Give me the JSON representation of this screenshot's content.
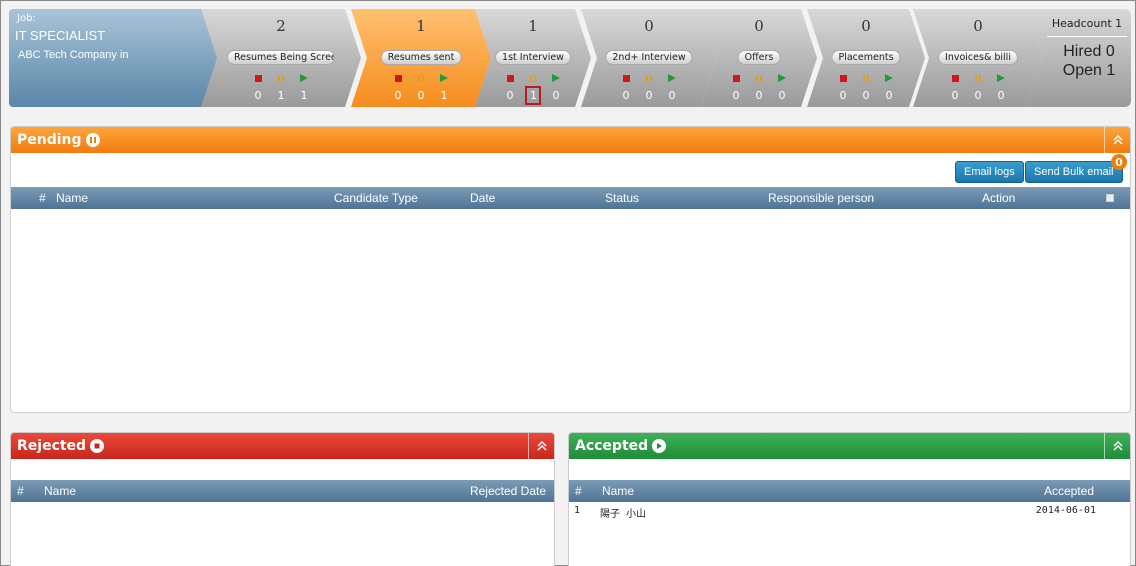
{
  "job": {
    "label": "Job:",
    "title": "IT SPECIALIST",
    "company": "ABC Tech Company in"
  },
  "stages": [
    {
      "count": "2",
      "label": "Resumes Being Scree",
      "stop": "0",
      "pause": "1",
      "play": "1",
      "active": false
    },
    {
      "count": "1",
      "label": "Resumes sent",
      "stop": "0",
      "pause": "0",
      "play": "1",
      "active": true
    },
    {
      "count": "1",
      "label": "1st Interview",
      "stop": "0",
      "pause": "1",
      "play": "0",
      "active": false
    },
    {
      "count": "0",
      "label": "2nd+ Interview",
      "stop": "0",
      "pause": "0",
      "play": "0",
      "active": false
    },
    {
      "count": "0",
      "label": "Offers",
      "stop": "0",
      "pause": "0",
      "play": "0",
      "active": false
    },
    {
      "count": "0",
      "label": "Placements",
      "stop": "0",
      "pause": "0",
      "play": "0",
      "active": false
    },
    {
      "count": "0",
      "label": "Invoices& billi",
      "stop": "0",
      "pause": "0",
      "play": "0",
      "active": false
    }
  ],
  "headcount": {
    "headcount": "Headcount 1",
    "hired": "Hired 0",
    "open": "Open 1"
  },
  "pending": {
    "title": "Pending",
    "email_logs": "Email logs",
    "bulk_email": "Send Bulk email",
    "badge": "0",
    "columns": {
      "num": "#",
      "name": "Name",
      "type": "Candidate Type",
      "date": "Date",
      "status": "Status",
      "responsible": "Responsible person",
      "action": "Action"
    }
  },
  "rejected": {
    "title": "Rejected",
    "columns": {
      "num": "#",
      "name": "Name",
      "date": "Rejected Date"
    }
  },
  "accepted": {
    "title": "Accepted",
    "columns": {
      "num": "#",
      "name": "Name",
      "date": "Accepted"
    },
    "rows": [
      {
        "num": "1",
        "name": "陽子 小山",
        "date": "2014-06-01"
      }
    ]
  },
  "colors": {
    "orange": "#f58d1e",
    "red": "#c8261b",
    "green": "#1f8c38",
    "steel": "#4f7495"
  }
}
